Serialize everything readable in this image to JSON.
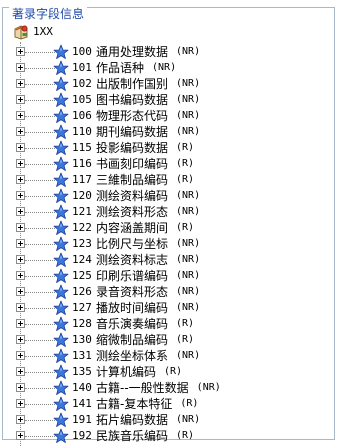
{
  "groupbox": {
    "title": "著录字段信息"
  },
  "tree": {
    "root_label": "1XX",
    "items": [
      {
        "code": "100",
        "name": "通用处理数据",
        "flag": "(NR)"
      },
      {
        "code": "101",
        "name": "作品语种",
        "flag": "(NR)"
      },
      {
        "code": "102",
        "name": "出版制作国别",
        "flag": "(NR)"
      },
      {
        "code": "105",
        "name": "图书编码数据",
        "flag": "(NR)"
      },
      {
        "code": "106",
        "name": "物理形态代码",
        "flag": "(NR)"
      },
      {
        "code": "110",
        "name": "期刊编码数据",
        "flag": "(NR)"
      },
      {
        "code": "115",
        "name": "投影编码数据",
        "flag": "(R)"
      },
      {
        "code": "116",
        "name": "书画刻印编码",
        "flag": "(R)"
      },
      {
        "code": "117",
        "name": "三維制品编码",
        "flag": "(R)"
      },
      {
        "code": "120",
        "name": "测绘资料编码",
        "flag": "(NR)"
      },
      {
        "code": "121",
        "name": "测绘资料形态",
        "flag": "(NR)"
      },
      {
        "code": "122",
        "name": "内容涵盖期间",
        "flag": "(R)"
      },
      {
        "code": "123",
        "name": "比例尺与坐标",
        "flag": "(NR)"
      },
      {
        "code": "124",
        "name": "测绘资料标志",
        "flag": "(NR)"
      },
      {
        "code": "125",
        "name": "印刷乐谱编码",
        "flag": "(NR)"
      },
      {
        "code": "126",
        "name": "录音资料形态",
        "flag": "(NR)"
      },
      {
        "code": "127",
        "name": "播放时间编码",
        "flag": "(NR)"
      },
      {
        "code": "128",
        "name": "音乐演奏编码",
        "flag": "(R)"
      },
      {
        "code": "130",
        "name": "缩微制品编码",
        "flag": "(R)"
      },
      {
        "code": "131",
        "name": "测绘坐标体系",
        "flag": "(NR)"
      },
      {
        "code": "135",
        "name": "计算机编码",
        "flag": "(R)"
      },
      {
        "code": "140",
        "name": "古籍--一般性数据",
        "flag": "(NR)"
      },
      {
        "code": "141",
        "name": "古籍-复本特征",
        "flag": "(R)"
      },
      {
        "code": "191",
        "name": "拓片编码数据",
        "flag": "(NR)"
      },
      {
        "code": "192",
        "name": "民族音乐编码",
        "flag": "(R)"
      }
    ]
  },
  "colors": {
    "legend_text": "#1f4aa6",
    "border": "#a9b8c9",
    "star_fill": "#3a78e0",
    "star_stroke": "#1b3f91"
  },
  "icons": {
    "root": "root-book-icon",
    "item": "star-icon",
    "expander": "plus-expander-icon"
  }
}
